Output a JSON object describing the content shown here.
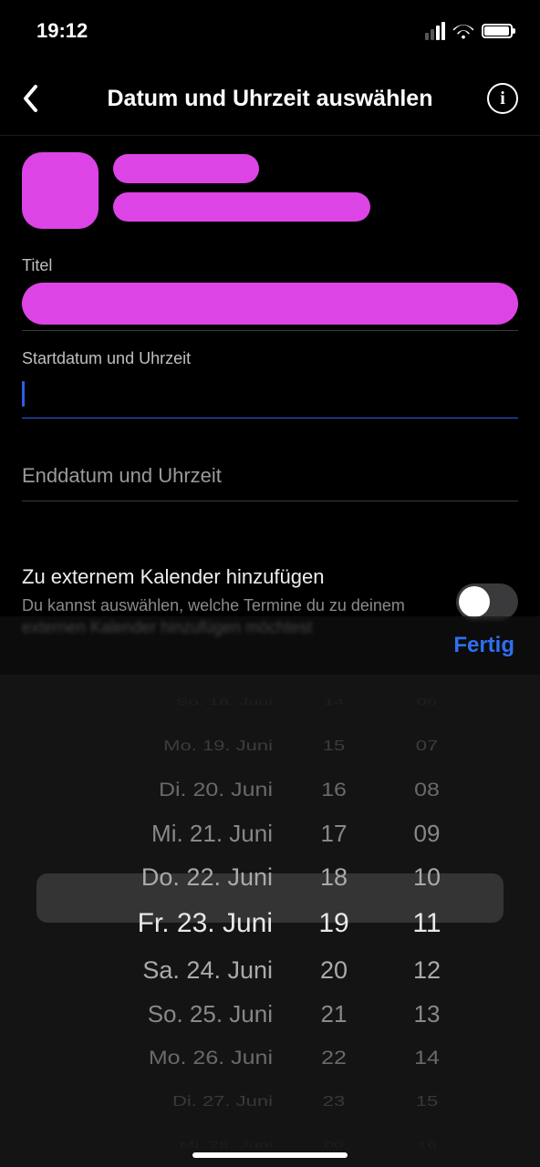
{
  "status": {
    "time": "19:12"
  },
  "header": {
    "title": "Datum und Uhrzeit auswählen"
  },
  "fields": {
    "title_label": "Titel",
    "start_label": "Startdatum und Uhrzeit",
    "end_placeholder": "Enddatum und Uhrzeit"
  },
  "toggle": {
    "title": "Zu externem Kalender hinzufügen",
    "subtitle": "Du kannst auswählen, welche Termine du zu deinem externen Kalender hinzufügen möchtest",
    "on": false
  },
  "picker": {
    "done_label": "Fertig",
    "dates": [
      "So. 18. Juni",
      "Mo. 19. Juni",
      "Di. 20. Juni",
      "Mi. 21. Juni",
      "Do. 22. Juni",
      "Fr. 23. Juni",
      "Sa. 24. Juni",
      "So. 25. Juni",
      "Mo. 26. Juni",
      "Di. 27. Juni",
      "Mi. 28. Juni"
    ],
    "hours": [
      "14",
      "15",
      "16",
      "17",
      "18",
      "19",
      "20",
      "21",
      "22",
      "23",
      "00"
    ],
    "minutes": [
      "06",
      "07",
      "08",
      "09",
      "10",
      "11",
      "12",
      "13",
      "14",
      "15",
      "16"
    ],
    "selected_index": 5
  },
  "colors": {
    "redaction": "#dd44e6",
    "accent": "#2e6ff2"
  }
}
